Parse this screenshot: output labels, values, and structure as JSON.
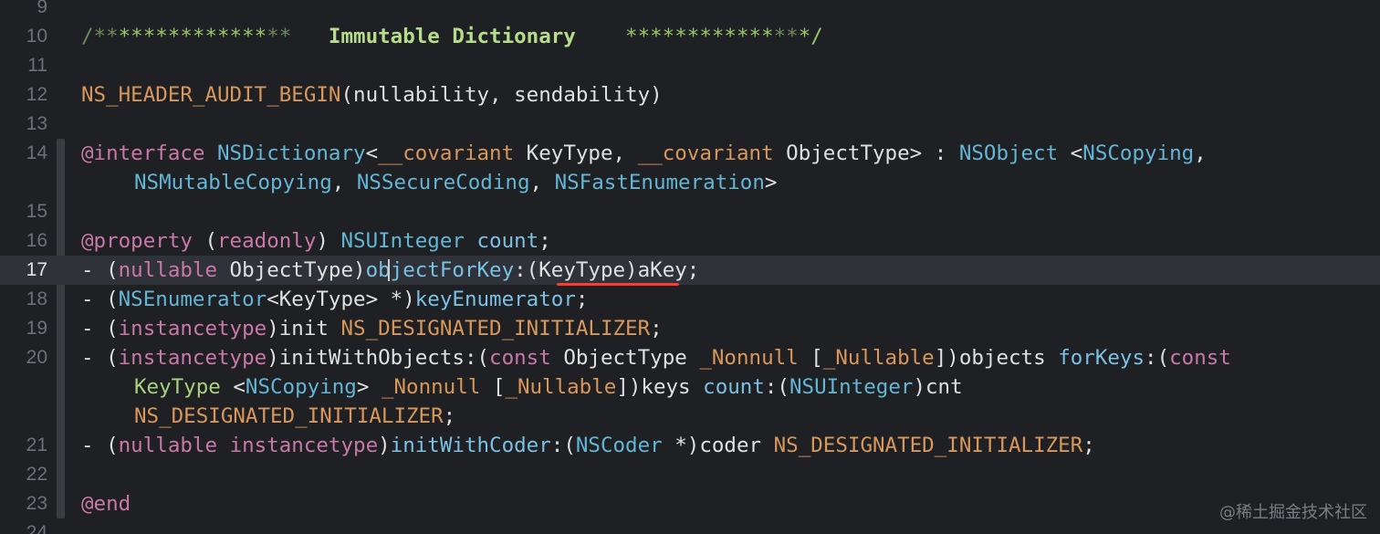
{
  "editor": {
    "current_line": "17",
    "watermark": "@稀土掘金技术社区",
    "lines": [
      {
        "num": "9",
        "tokens": []
      },
      {
        "num": "10",
        "tokens": [
          {
            "t": "/**",
            "c": "comment-faint"
          },
          {
            "t": "************",
            "c": "comment-star"
          },
          {
            "t": "**",
            "c": "comment-faint"
          },
          {
            "t": "   Immutable Dictionary    ",
            "c": "comment-strong"
          },
          {
            "t": "************",
            "c": "comment-star"
          },
          {
            "t": "**",
            "c": "comment-faint"
          },
          {
            "t": "*/",
            "c": "comment-star"
          }
        ]
      },
      {
        "num": "11",
        "tokens": []
      },
      {
        "num": "12",
        "tokens": [
          {
            "t": "NS_HEADER_AUDIT_BEGIN",
            "c": "macro"
          },
          {
            "t": "(nullability, sendability)",
            "c": "plain"
          }
        ]
      },
      {
        "num": "13",
        "tokens": []
      },
      {
        "num": "14",
        "tokens": [
          {
            "t": "@interface",
            "c": "kw"
          },
          {
            "t": " ",
            "c": "plain"
          },
          {
            "t": "NSDictionary",
            "c": "type"
          },
          {
            "t": "<",
            "c": "plain"
          },
          {
            "t": "__covariant",
            "c": "macro"
          },
          {
            "t": " KeyType, ",
            "c": "plain"
          },
          {
            "t": "__covariant",
            "c": "macro"
          },
          {
            "t": " ObjectType> : ",
            "c": "plain"
          },
          {
            "t": "NSObject",
            "c": "type"
          },
          {
            "t": " <",
            "c": "plain"
          },
          {
            "t": "NSCopying",
            "c": "type"
          },
          {
            "t": ",",
            "c": "plain"
          }
        ]
      },
      {
        "num": "",
        "wrap": true,
        "tokens": [
          {
            "t": "NSMutableCopying",
            "c": "type"
          },
          {
            "t": ", ",
            "c": "plain"
          },
          {
            "t": "NSSecureCoding",
            "c": "type"
          },
          {
            "t": ", ",
            "c": "plain"
          },
          {
            "t": "NSFastEnumeration",
            "c": "type"
          },
          {
            "t": ">",
            "c": "plain"
          }
        ]
      },
      {
        "num": "15",
        "tokens": []
      },
      {
        "num": "16",
        "tokens": [
          {
            "t": "@property",
            "c": "kw"
          },
          {
            "t": " (",
            "c": "plain"
          },
          {
            "t": "readonly",
            "c": "kw"
          },
          {
            "t": ") ",
            "c": "plain"
          },
          {
            "t": "NSUInteger",
            "c": "type"
          },
          {
            "t": " ",
            "c": "plain"
          },
          {
            "t": "count",
            "c": "method"
          },
          {
            "t": ";",
            "c": "plain"
          }
        ]
      },
      {
        "num": "17",
        "tokens": [
          {
            "t": "- (",
            "c": "plain"
          },
          {
            "t": "nullable",
            "c": "kw"
          },
          {
            "t": " ObjectType)",
            "c": "plain"
          },
          {
            "t": "objectForKey",
            "c": "method"
          },
          {
            "t": ":(KeyType)aKey;",
            "c": "plain"
          }
        ]
      },
      {
        "num": "18",
        "tokens": [
          {
            "t": "- (",
            "c": "plain"
          },
          {
            "t": "NSEnumerator",
            "c": "type"
          },
          {
            "t": "<KeyType> *)",
            "c": "plain"
          },
          {
            "t": "keyEnumerator",
            "c": "method"
          },
          {
            "t": ";",
            "c": "plain"
          }
        ]
      },
      {
        "num": "19",
        "tokens": [
          {
            "t": "- (",
            "c": "plain"
          },
          {
            "t": "instancetype",
            "c": "kw"
          },
          {
            "t": ")init ",
            "c": "plain"
          },
          {
            "t": "NS_DESIGNATED_INITIALIZER",
            "c": "macro"
          },
          {
            "t": ";",
            "c": "plain"
          }
        ]
      },
      {
        "num": "20",
        "tokens": [
          {
            "t": "- (",
            "c": "plain"
          },
          {
            "t": "instancetype",
            "c": "kw"
          },
          {
            "t": ")initWithObjects:(",
            "c": "plain"
          },
          {
            "t": "const",
            "c": "kw"
          },
          {
            "t": " ObjectType ",
            "c": "plain"
          },
          {
            "t": "_Nonnull",
            "c": "macro"
          },
          {
            "t": " [",
            "c": "plain"
          },
          {
            "t": "_Nullable",
            "c": "macro"
          },
          {
            "t": "])objects ",
            "c": "plain"
          },
          {
            "t": "forKeys",
            "c": "method"
          },
          {
            "t": ":(",
            "c": "plain"
          },
          {
            "t": "const",
            "c": "kw"
          }
        ]
      },
      {
        "num": "",
        "wrap": true,
        "tokens": [
          {
            "t": "KeyType",
            "c": "green"
          },
          {
            "t": " <",
            "c": "plain"
          },
          {
            "t": "NSCopying",
            "c": "type"
          },
          {
            "t": "> ",
            "c": "plain"
          },
          {
            "t": "_Nonnull",
            "c": "macro"
          },
          {
            "t": " [",
            "c": "plain"
          },
          {
            "t": "_Nullable",
            "c": "macro"
          },
          {
            "t": "])keys ",
            "c": "plain"
          },
          {
            "t": "count",
            "c": "method"
          },
          {
            "t": ":(",
            "c": "plain"
          },
          {
            "t": "NSUInteger",
            "c": "type"
          },
          {
            "t": ")cnt",
            "c": "plain"
          }
        ]
      },
      {
        "num": "",
        "wrap": true,
        "tokens": [
          {
            "t": "NS_DESIGNATED_INITIALIZER",
            "c": "macro"
          },
          {
            "t": ";",
            "c": "plain"
          }
        ]
      },
      {
        "num": "21",
        "tokens": [
          {
            "t": "- (",
            "c": "plain"
          },
          {
            "t": "nullable",
            "c": "kw"
          },
          {
            "t": " ",
            "c": "plain"
          },
          {
            "t": "instancetype",
            "c": "kw"
          },
          {
            "t": ")",
            "c": "plain"
          },
          {
            "t": "initWithCoder",
            "c": "method"
          },
          {
            "t": ":(",
            "c": "plain"
          },
          {
            "t": "NSCoder",
            "c": "type"
          },
          {
            "t": " *)coder ",
            "c": "plain"
          },
          {
            "t": "NS_DESIGNATED_INITIALIZER",
            "c": "macro"
          },
          {
            "t": ";",
            "c": "plain"
          }
        ]
      },
      {
        "num": "22",
        "tokens": []
      },
      {
        "num": "23",
        "tokens": [
          {
            "t": "@end",
            "c": "kw"
          }
        ]
      },
      {
        "num": "24",
        "tokens": []
      }
    ]
  }
}
